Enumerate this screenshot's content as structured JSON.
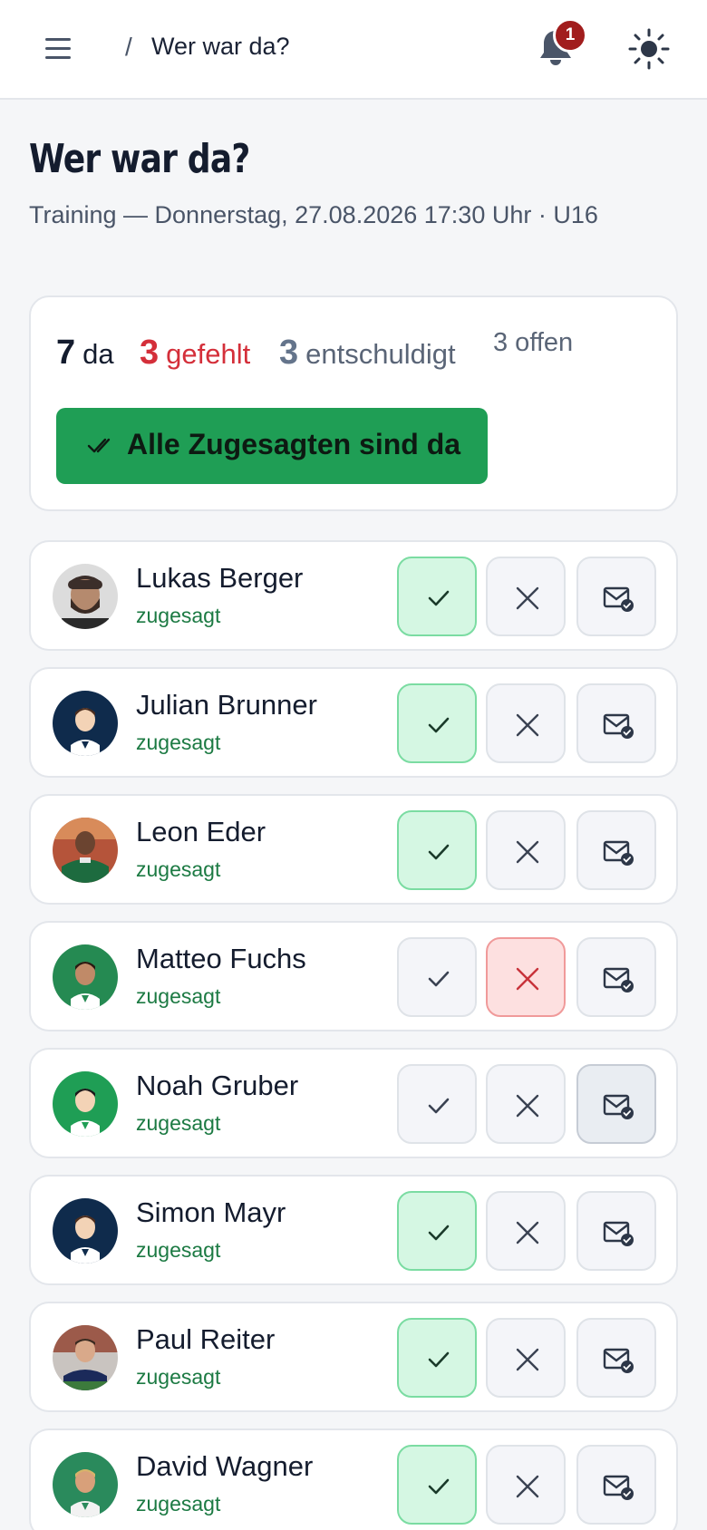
{
  "header": {
    "breadcrumb_sep": "/",
    "breadcrumb_title": "Wer war da?",
    "notification_count": "1",
    "icons": [
      "menu-icon",
      "bell-icon",
      "sun-icon"
    ]
  },
  "page": {
    "title": "Wer war da?",
    "subtitle": "Training — Donnerstag, 27.08.2026 17:30 Uhr · U16"
  },
  "summary": {
    "present_count": "7",
    "present_label": "da",
    "absent_count": "3",
    "absent_label": "gefehlt",
    "excused_count": "3",
    "excused_label": "entschuldigt",
    "open_label": "3 offen",
    "all_button_label": "Alle Zugesagten sind da"
  },
  "colors": {
    "accent_green": "#1f9e55",
    "absent_red": "#d42f3a",
    "excused_slate": "#64748b"
  },
  "players": [
    {
      "name": "Lukas Berger",
      "status": "zugesagt",
      "selected": "present",
      "avatar": "photo-bearded-man"
    },
    {
      "name": "Julian Brunner",
      "status": "zugesagt",
      "selected": "present",
      "avatar": "illustrated-navy"
    },
    {
      "name": "Leon Eder",
      "status": "zugesagt",
      "selected": "present",
      "avatar": "photo-green-jersey"
    },
    {
      "name": "Matteo Fuchs",
      "status": "zugesagt",
      "selected": "absent",
      "avatar": "illustrated-green-dark"
    },
    {
      "name": "Noah Gruber",
      "status": "zugesagt",
      "selected": "excused",
      "avatar": "illustrated-green"
    },
    {
      "name": "Simon Mayr",
      "status": "zugesagt",
      "selected": "present",
      "avatar": "illustrated-navy"
    },
    {
      "name": "Paul Reiter",
      "status": "zugesagt",
      "selected": "present",
      "avatar": "photo-stadium"
    },
    {
      "name": "David Wagner",
      "status": "zugesagt",
      "selected": "present",
      "avatar": "illustrated-green-blond"
    }
  ]
}
